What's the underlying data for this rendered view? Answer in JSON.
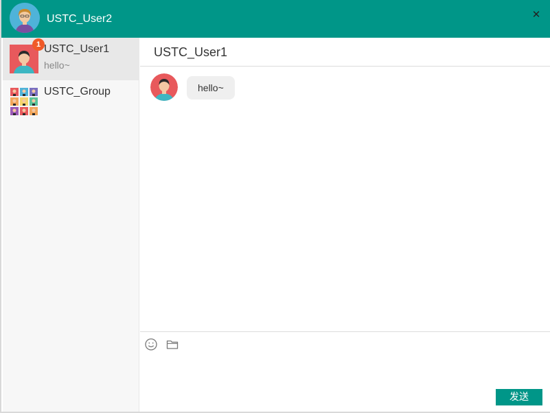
{
  "titlebar": {
    "user_name": "USTC_User2",
    "close_symbol": "✕",
    "avatar_icon": "female-user-avatar-icon",
    "close_icon": "close-icon"
  },
  "sidebar": {
    "contacts": [
      {
        "name": "USTC_User1",
        "preview": "hello~",
        "unread": "1",
        "avatar_icon": "male-user-avatar-icon",
        "active": true
      },
      {
        "name": "USTC_Group",
        "preview": "",
        "unread": "",
        "avatar_icon": "group-avatar-icon",
        "active": false
      }
    ]
  },
  "chat": {
    "title": "USTC_User1",
    "messages": [
      {
        "sender_avatar_icon": "male-user-avatar-icon",
        "text": "hello~"
      }
    ]
  },
  "composer": {
    "emoji_icon": "smiley-icon",
    "file_icon": "folder-icon",
    "input_value": "",
    "send_label": "发送"
  },
  "colors": {
    "accent": "#009688",
    "badge": "#f05a28",
    "sidebar_bg": "#f7f7f7",
    "active_contact_bg": "#e8e8e8",
    "bubble_bg": "#efefef"
  }
}
